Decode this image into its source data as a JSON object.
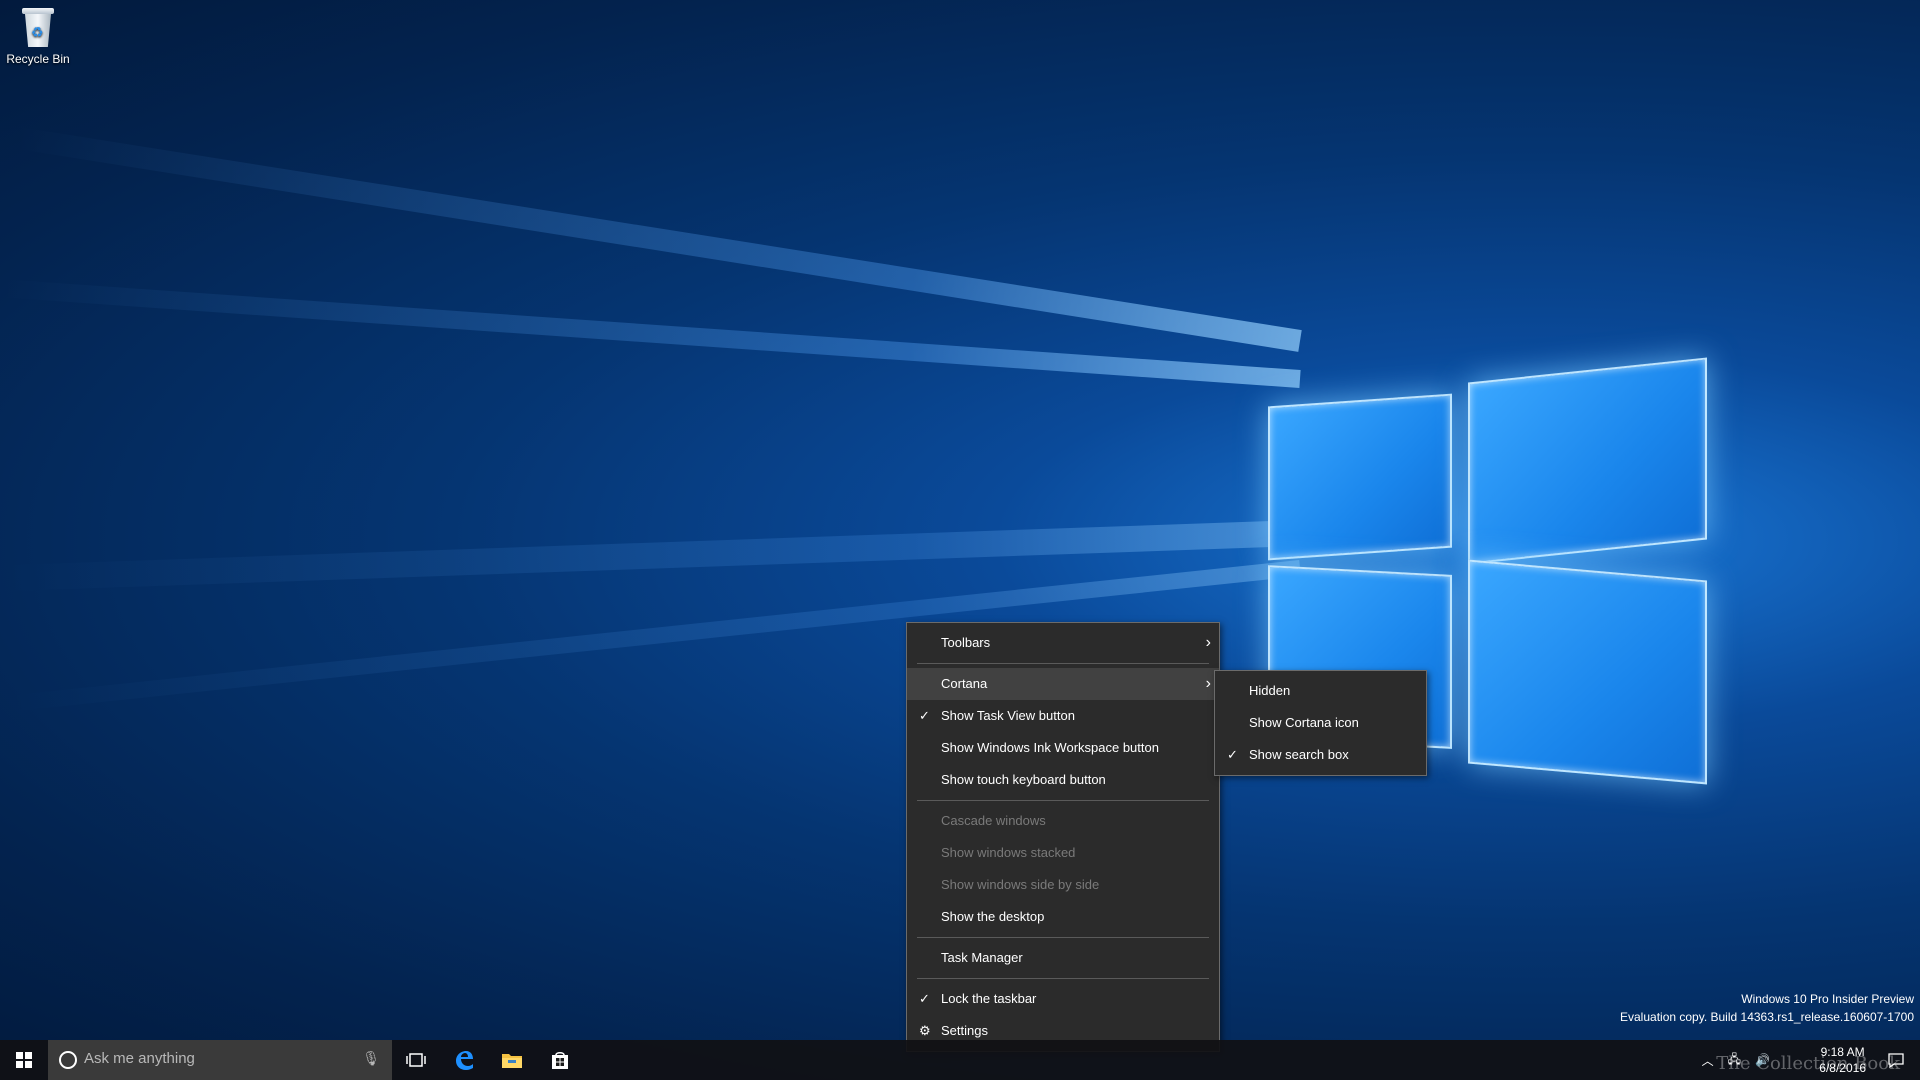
{
  "desktop": {
    "icons": [
      {
        "label": "Recycle Bin",
        "icon": "recycle-bin-icon"
      }
    ]
  },
  "context_menu": {
    "items": [
      {
        "label": "Toolbars",
        "checked": false,
        "disabled": false,
        "submenu": true
      },
      {
        "label": "Cortana",
        "checked": false,
        "disabled": false,
        "submenu": true,
        "highlighted": true
      },
      {
        "label": "Show Task View button",
        "checked": true,
        "disabled": false
      },
      {
        "label": "Show Windows Ink Workspace button",
        "checked": false,
        "disabled": false
      },
      {
        "label": "Show touch keyboard button",
        "checked": false,
        "disabled": false
      },
      {
        "label": "Cascade windows",
        "checked": false,
        "disabled": true
      },
      {
        "label": "Show windows stacked",
        "checked": false,
        "disabled": true
      },
      {
        "label": "Show windows side by side",
        "checked": false,
        "disabled": true
      },
      {
        "label": "Show the desktop",
        "checked": false,
        "disabled": false
      },
      {
        "label": "Task Manager",
        "checked": false,
        "disabled": false
      },
      {
        "label": "Lock the taskbar",
        "checked": true,
        "disabled": false
      },
      {
        "label": "Settings",
        "checked": false,
        "disabled": false,
        "icon": "gear-icon"
      }
    ]
  },
  "cortana_submenu": {
    "items": [
      {
        "label": "Hidden",
        "checked": false
      },
      {
        "label": "Show Cortana icon",
        "checked": false
      },
      {
        "label": "Show search box",
        "checked": true
      }
    ]
  },
  "taskbar": {
    "search_placeholder": "Ask me anything",
    "pinned": [
      "task-view-icon",
      "edge-icon",
      "file-explorer-icon",
      "store-icon"
    ],
    "clock_time": "9:18 AM",
    "clock_date": "6/8/2016"
  },
  "watermark": {
    "line1": "Windows 10 Pro Insider Preview",
    "line2": "Evaluation copy. Build 14363.rs1_release.160607-1700",
    "brand": "The Collection Book"
  },
  "glyphs": {
    "check": "✓",
    "arrow": "›"
  }
}
